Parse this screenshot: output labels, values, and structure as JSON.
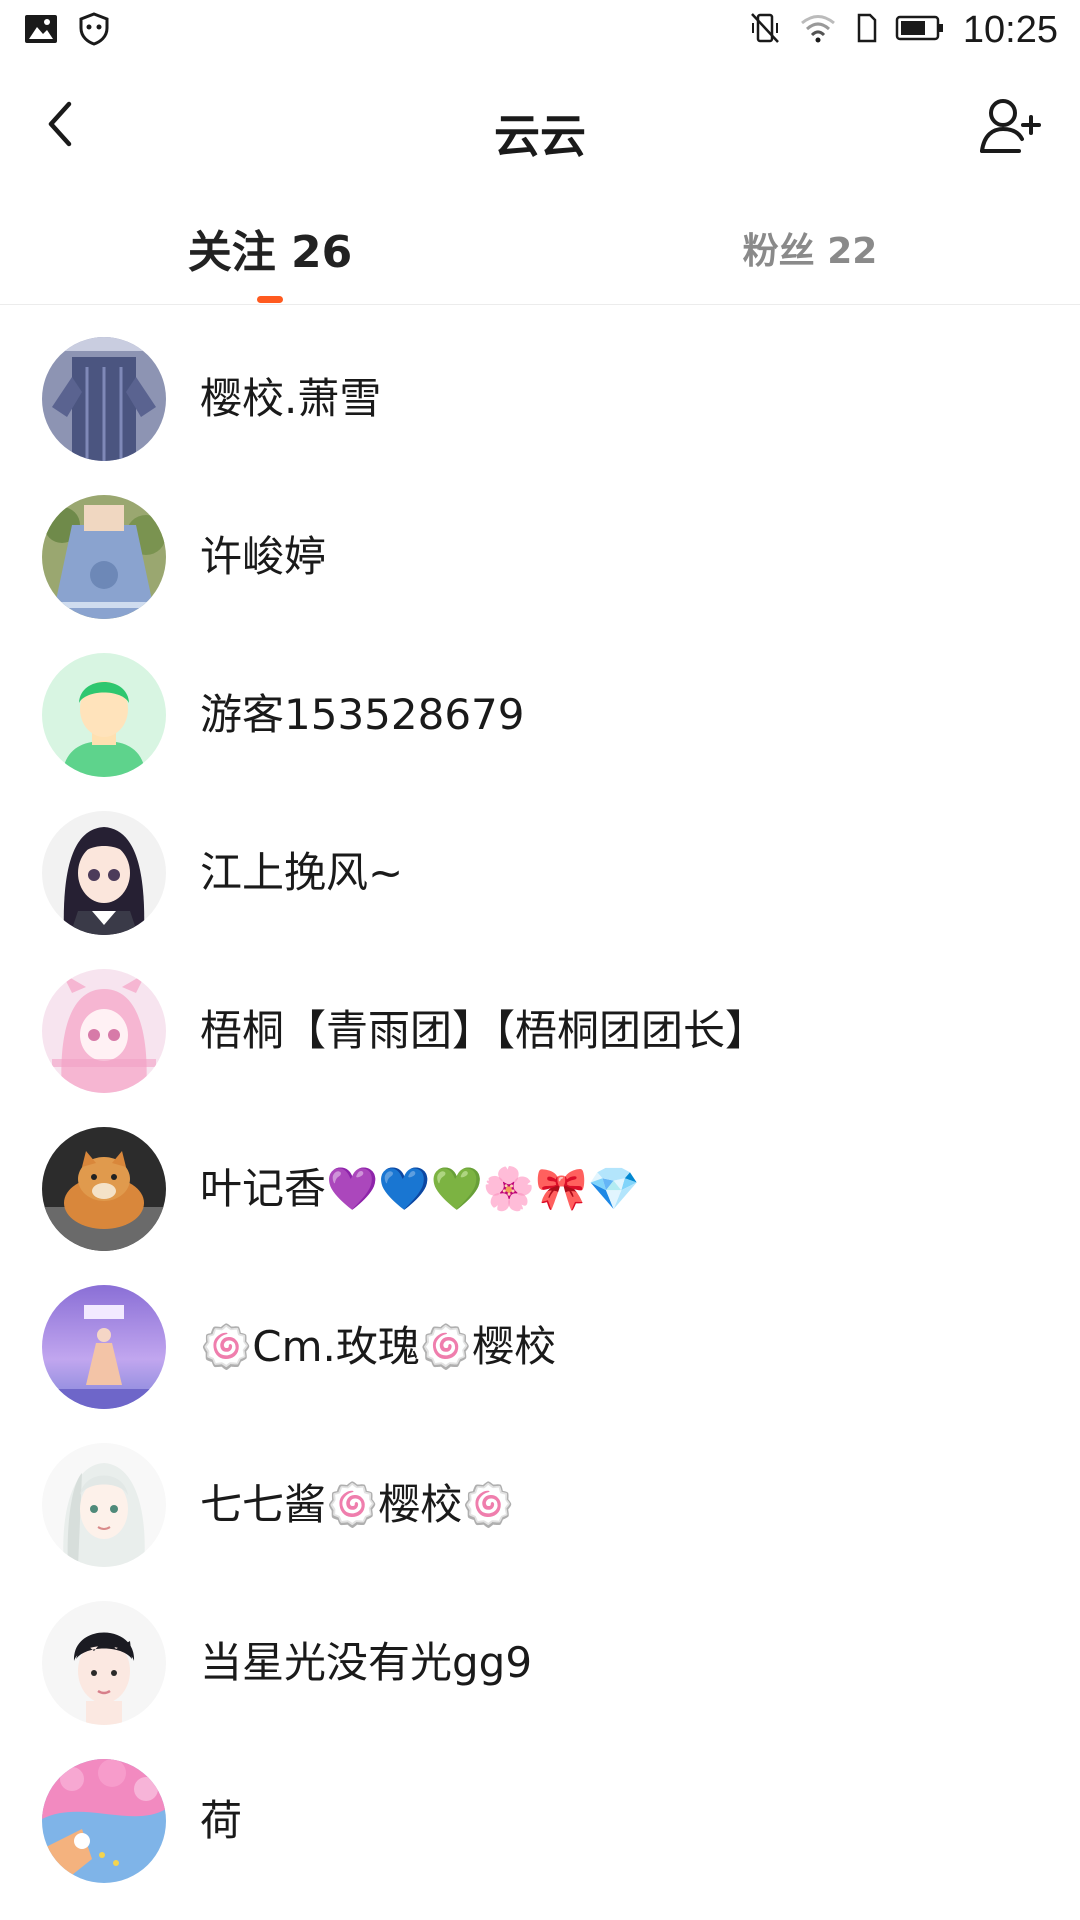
{
  "status_bar": {
    "time": "10:25",
    "icons": [
      "image-icon",
      "shield-icon",
      "vibrate-off-icon",
      "wifi-icon",
      "sim-icon",
      "battery-icon"
    ]
  },
  "header": {
    "title": "云云",
    "back_icon": "chevron-left-icon",
    "add_icon": "add-user-icon"
  },
  "tabs": [
    {
      "label": "关注 26",
      "active": true
    },
    {
      "label": "粉丝 22",
      "active": false
    }
  ],
  "colors": {
    "accent": "#ff5a1f",
    "active_tab": "#222222",
    "inactive_tab": "#8a8a8a"
  },
  "users": [
    {
      "name": "樱校.萧雪"
    },
    {
      "name": "许峻婷"
    },
    {
      "name": "游客153528679"
    },
    {
      "name": "江上挽风~"
    },
    {
      "name": "梧桐【青雨团】【梧桐团团长】"
    },
    {
      "name": "叶记香💜💙💚🌸🎀💎"
    },
    {
      "name": "🍥Cm.玫瑰🍥樱校"
    },
    {
      "name": "七七酱🍥樱校🍥"
    },
    {
      "name": "当星光没有光gg9"
    },
    {
      "name": "荷"
    }
  ]
}
